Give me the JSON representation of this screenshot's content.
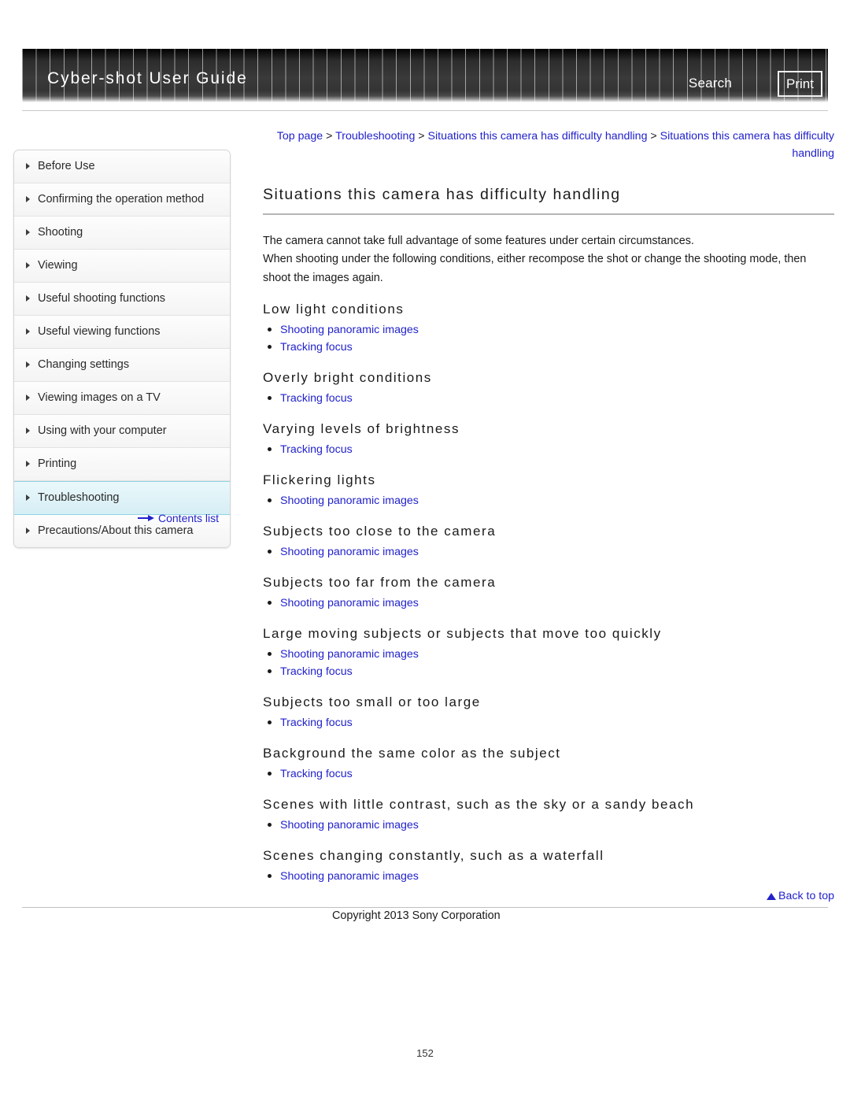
{
  "header": {
    "title": "Cyber-shot User Guide",
    "search_label": "Search",
    "print_label": "Print"
  },
  "sidebar": {
    "items": [
      {
        "label": "Before Use",
        "active": false
      },
      {
        "label": "Confirming the operation method",
        "active": false
      },
      {
        "label": "Shooting",
        "active": false
      },
      {
        "label": "Viewing",
        "active": false
      },
      {
        "label": "Useful shooting functions",
        "active": false
      },
      {
        "label": "Useful viewing functions",
        "active": false
      },
      {
        "label": "Changing settings",
        "active": false
      },
      {
        "label": "Viewing images on a TV",
        "active": false
      },
      {
        "label": "Using with your computer",
        "active": false
      },
      {
        "label": "Printing",
        "active": false
      },
      {
        "label": "Troubleshooting",
        "active": true
      },
      {
        "label": "Precautions/About this camera",
        "active": false
      }
    ],
    "contents_list_label": "Contents list"
  },
  "breadcrumb": {
    "crumbs": [
      "Top page",
      "Troubleshooting",
      "Situations this camera has difficulty handling",
      "Situations this camera has difficulty handling"
    ],
    "separator": ">"
  },
  "main": {
    "title": "Situations this camera has difficulty handling",
    "intro_lines": [
      "The camera cannot take full advantage of some features under certain circumstances.",
      "When shooting under the following conditions, either recompose the shot or change the shooting mode, then shoot the images again."
    ],
    "sections": [
      {
        "heading": "Low light conditions",
        "links": [
          "Shooting panoramic images",
          "Tracking focus"
        ]
      },
      {
        "heading": "Overly bright conditions",
        "links": [
          "Tracking focus"
        ]
      },
      {
        "heading": "Varying levels of brightness",
        "links": [
          "Tracking focus"
        ]
      },
      {
        "heading": "Flickering lights",
        "links": [
          "Shooting panoramic images"
        ]
      },
      {
        "heading": "Subjects too close to the camera",
        "links": [
          "Shooting panoramic images"
        ]
      },
      {
        "heading": "Subjects too far from the camera",
        "links": [
          "Shooting panoramic images"
        ]
      },
      {
        "heading": "Large moving subjects or subjects that move too quickly",
        "links": [
          "Shooting panoramic images",
          "Tracking focus"
        ]
      },
      {
        "heading": "Subjects too small or too large",
        "links": [
          "Tracking focus"
        ]
      },
      {
        "heading": "Background the same color as the subject",
        "links": [
          "Tracking focus"
        ]
      },
      {
        "heading": "Scenes with little contrast, such as the sky or a sandy beach",
        "links": [
          "Shooting panoramic images"
        ]
      },
      {
        "heading": "Scenes changing constantly, such as a waterfall",
        "links": [
          "Shooting panoramic images"
        ]
      }
    ]
  },
  "footer": {
    "back_to_top_label": "Back to top",
    "copyright": "Copyright 2013 Sony Corporation",
    "page_number": "152"
  },
  "colors": {
    "link": "#2222cc",
    "header_bg": "#303030",
    "active_nav": "#d6eef5",
    "rule": "#b5b5b5"
  }
}
